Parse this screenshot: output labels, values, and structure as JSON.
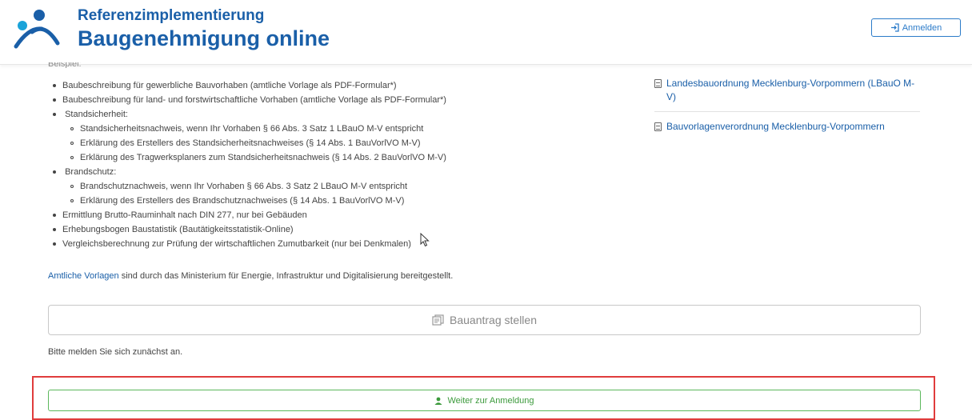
{
  "header": {
    "title_small": "Referenzimplementierung",
    "title_big": "Baugenehmigung online",
    "login_label": "Anmelden"
  },
  "main": {
    "cut_heading": "Beispiel:",
    "items": [
      {
        "label": "Baubeschreibung für gewerbliche Bauvorhaben (amtliche Vorlage als PDF-Formular*)"
      },
      {
        "label": "Baubeschreibung für land- und forstwirtschaftliche Vorhaben (amtliche Vorlage als PDF-Formular*)"
      },
      {
        "label": "Standsicherheit:"
      },
      {
        "label": "Brandschutz:"
      },
      {
        "label": "Ermittlung Brutto-Rauminhalt nach DIN 277, nur bei Gebäuden"
      },
      {
        "label": "Erhebungsbogen Baustatistik (Bautätigkeitsstatistik-Online)"
      },
      {
        "label": "Vergleichsberechnung zur Prüfung der wirtschaftlichen Zumutbarkeit (nur bei Denkmalen)"
      }
    ],
    "standsicherheit_sub": [
      "Standsicherheitsnachweis, wenn Ihr Vorhaben § 66 Abs. 3 Satz 1 LBauO M-V entspricht",
      "Erklärung des Erstellers des Standsicherheitsnachweises (§ 14 Abs. 1 BauVorlVO M-V)",
      "Erklärung des Tragwerksplaners zum Standsicherheitsnachweis (§ 14  Abs. 2 BauVorlVO M-V)"
    ],
    "brandschutz_sub": [
      "Brandschutznachweis, wenn Ihr Vorhaben § 66 Abs. 3 Satz 2 LBauO M-V entspricht",
      "Erklärung des Erstellers des Brandschutznachweises (§ 14 Abs. 1 BauVorlVO M-V)"
    ],
    "amtlich_link": "Amtliche Vorlagen",
    "amtlich_text": " sind durch das Ministerium für Energie, Infrastruktur und Digitalisierung bereitgestellt.",
    "bauantrag_label": "Bauantrag stellen",
    "hint": "Bitte melden Sie sich zunächst an.",
    "weiter_label": "Weiter zur Anmeldung"
  },
  "sidebar": {
    "links": [
      "Landesbauordnung Mecklenburg-Vorpommern (LBauO M-V)",
      "Bauvorlagenverordnung Mecklenburg-Vorpommern"
    ]
  },
  "colors": {
    "brand": "#1a5fa8",
    "success": "#5cb85c",
    "highlight": "#e03c3c"
  }
}
